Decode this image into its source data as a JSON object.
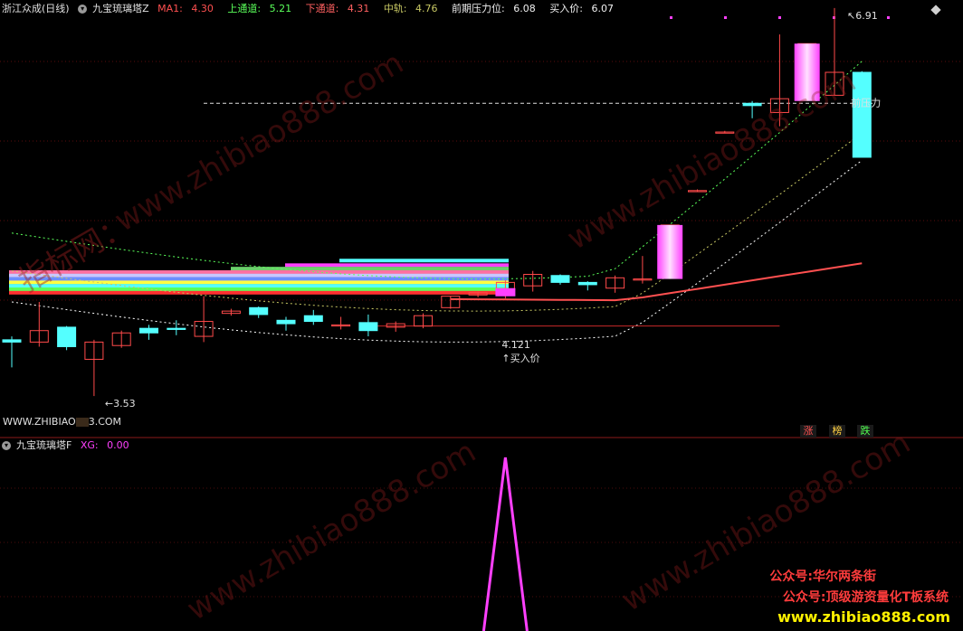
{
  "header": {
    "stock_name": "浙江众成(日线)",
    "indicator_name": "九宝琉璃塔Z",
    "ma1_label": "MA1:",
    "ma1_value": "4.30",
    "upper_label": "上通道:",
    "upper_value": "5.21",
    "lower_label": "下通道:",
    "lower_value": "4.31",
    "mid_label": "中轨:",
    "mid_value": "4.76",
    "resist_label": "前期压力位:",
    "resist_value": "6.08",
    "buy_label": "买入价:",
    "buy_value": "6.07"
  },
  "annotations": {
    "high_label": "6.91",
    "low_label": "3.53",
    "resist_text": "前压力",
    "buy_price_value": "4.121",
    "buy_price_text": "买入价"
  },
  "footer": {
    "site": "WWW.ZHIBIAO",
    "site_suffix": "3.COM",
    "btn_zhang": "涨",
    "btn_bang": "榜",
    "btn_die": "跌"
  },
  "sub_header": {
    "indicator_name": "九宝琉璃塔F",
    "xg_label": "XG:",
    "xg_value": "0.00"
  },
  "promo": {
    "line1": "公众号:华尔两条街",
    "line2": "公众号:顶级游资量化T板系统",
    "line3": "www.zhibiao888.com"
  },
  "watermarks": [
    "www.zhibiao888.com",
    "指标网：",
    "www.zhibiao888.com"
  ],
  "colors": {
    "up": "#ff4a4a",
    "down": "#54ffff",
    "ma1": "#ff5050",
    "upper": "#5aff5a",
    "lower": "#ff5050",
    "mid": "#c8c864",
    "magenta": "#ff40ff",
    "background": "#000000"
  },
  "chart_data": {
    "type": "candlestick",
    "candles": [
      {
        "o": 4.02,
        "h": 4.05,
        "l": 3.78,
        "c": 4.0
      },
      {
        "o": 4.0,
        "h": 4.35,
        "l": 3.96,
        "c": 4.1
      },
      {
        "o": 4.13,
        "h": 4.14,
        "l": 3.93,
        "c": 3.96
      },
      {
        "o": 3.85,
        "h": 4.02,
        "l": 3.53,
        "c": 4.0
      },
      {
        "o": 3.97,
        "h": 4.1,
        "l": 3.95,
        "c": 4.08
      },
      {
        "o": 4.12,
        "h": 4.15,
        "l": 4.02,
        "c": 4.08
      },
      {
        "o": 4.12,
        "h": 4.19,
        "l": 4.06,
        "c": 4.11
      },
      {
        "o": 4.05,
        "h": 4.4,
        "l": 4.0,
        "c": 4.18
      },
      {
        "o": 4.25,
        "h": 4.29,
        "l": 4.23,
        "c": 4.27
      },
      {
        "o": 4.3,
        "h": 4.31,
        "l": 4.21,
        "c": 4.24
      },
      {
        "o": 4.19,
        "h": 4.22,
        "l": 4.1,
        "c": 4.16
      },
      {
        "o": 4.23,
        "h": 4.28,
        "l": 4.15,
        "c": 4.18
      },
      {
        "o": 4.14,
        "h": 4.22,
        "l": 4.11,
        "c": 4.15
      },
      {
        "o": 4.17,
        "h": 4.24,
        "l": 4.05,
        "c": 4.1
      },
      {
        "o": 4.13,
        "h": 4.18,
        "l": 4.09,
        "c": 4.16
      },
      {
        "o": 4.14,
        "h": 4.25,
        "l": 4.12,
        "c": 4.23
      },
      {
        "o": 4.3,
        "h": 4.4,
        "l": 4.29,
        "c": 4.4
      },
      {
        "o": 4.41,
        "h": 4.44,
        "l": 4.39,
        "c": 4.43
      },
      {
        "o": 4.46,
        "h": 4.54,
        "l": 4.38,
        "c": 4.52
      },
      {
        "o": 4.49,
        "h": 4.62,
        "l": 4.44,
        "c": 4.59
      },
      {
        "o": 4.58,
        "h": 4.59,
        "l": 4.5,
        "c": 4.52
      },
      {
        "o": 4.52,
        "h": 4.53,
        "l": 4.45,
        "c": 4.5
      },
      {
        "o": 4.47,
        "h": 4.58,
        "l": 4.43,
        "c": 4.56
      },
      {
        "o": 4.54,
        "h": 4.75,
        "l": 4.51,
        "c": 4.55
      },
      {
        "o": 4.57,
        "h": 5.02,
        "l": 4.55,
        "c": 5.02
      },
      {
        "o": 5.31,
        "h": 5.33,
        "l": 5.31,
        "c": 5.32
      },
      {
        "o": 5.82,
        "h": 5.84,
        "l": 5.82,
        "c": 5.83
      },
      {
        "o": 6.08,
        "h": 6.1,
        "l": 5.95,
        "c": 6.06
      },
      {
        "o": 6.0,
        "h": 6.68,
        "l": 5.88,
        "c": 6.12
      },
      {
        "o": 6.12,
        "h": 6.6,
        "l": 6.1,
        "c": 6.6
      },
      {
        "o": 6.15,
        "h": 6.91,
        "l": 6.15,
        "c": 6.35
      },
      {
        "o": 6.35,
        "h": 6.36,
        "l": 5.61,
        "c": 5.61
      }
    ],
    "special_bars": [
      {
        "index": 24,
        "low": 4.55,
        "high": 5.02
      },
      {
        "index": 29,
        "low": 6.1,
        "high": 6.6
      }
    ],
    "resistance_level": 6.08,
    "buy_price": 4.121,
    "price_range": [
      3.2,
      6.98
    ],
    "xg_signal_index": 18
  }
}
